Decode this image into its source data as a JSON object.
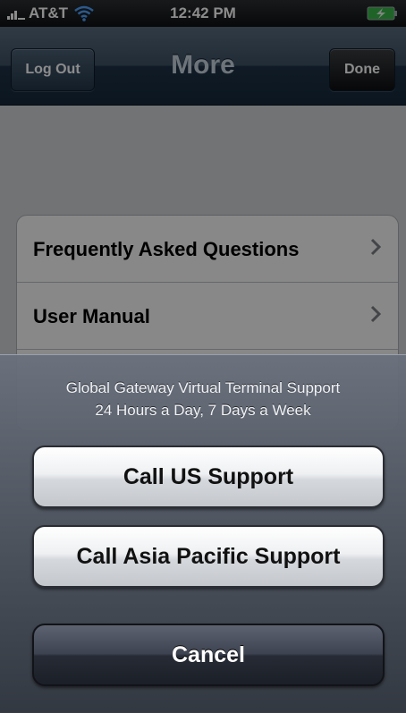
{
  "status_bar": {
    "carrier": "AT&T",
    "time": "12:42 PM",
    "icons": [
      "signal-icon",
      "wifi-icon",
      "battery-charging-icon"
    ]
  },
  "nav_bar": {
    "title": "More",
    "left_button": "Log Out",
    "right_button": "Done"
  },
  "table": {
    "rows": [
      {
        "label": "Frequently Asked Questions",
        "icon": "chevron-right-icon"
      },
      {
        "label": "User Manual",
        "icon": "chevron-right-icon"
      }
    ]
  },
  "action_sheet": {
    "title_line1": "Global Gateway Virtual Terminal Support",
    "title_line2": "24 Hours a Day, 7 Days a Week",
    "buttons": [
      {
        "label": "Call US Support"
      },
      {
        "label": "Call Asia Pacific Support"
      }
    ],
    "cancel": "Cancel"
  },
  "colors": {
    "nav_bar": "#1e3246",
    "sheet_background": "#444b56",
    "cancel_button": "#262b35"
  }
}
